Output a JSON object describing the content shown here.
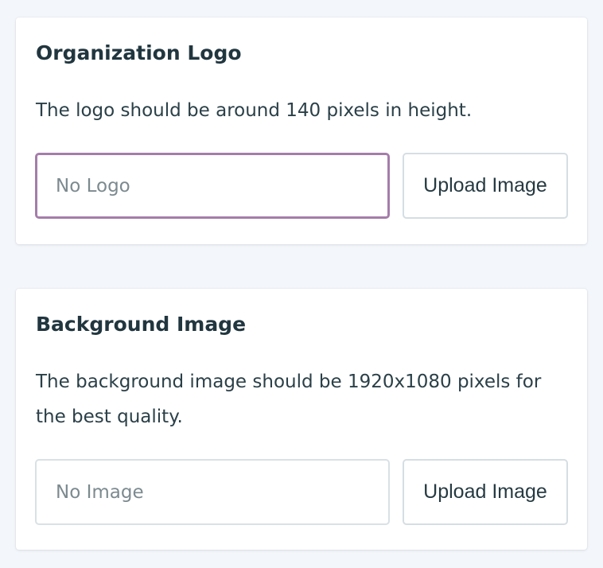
{
  "logo_section": {
    "title": "Organization Logo",
    "description": "The logo should be around 140 pixels in height.",
    "field_value": "No Logo",
    "upload_label": "Upload Image"
  },
  "background_section": {
    "title": "Background Image",
    "description": "The background image should be 1920x1080 pixels for the best quality.",
    "field_value": "No Image",
    "upload_label": "Upload Image"
  },
  "colors": {
    "page_background": "#f3f6fa",
    "card_background": "#ffffff",
    "title_text": "#21363f",
    "focus_border": "#a57daa",
    "field_border": "#d9e1e6"
  }
}
